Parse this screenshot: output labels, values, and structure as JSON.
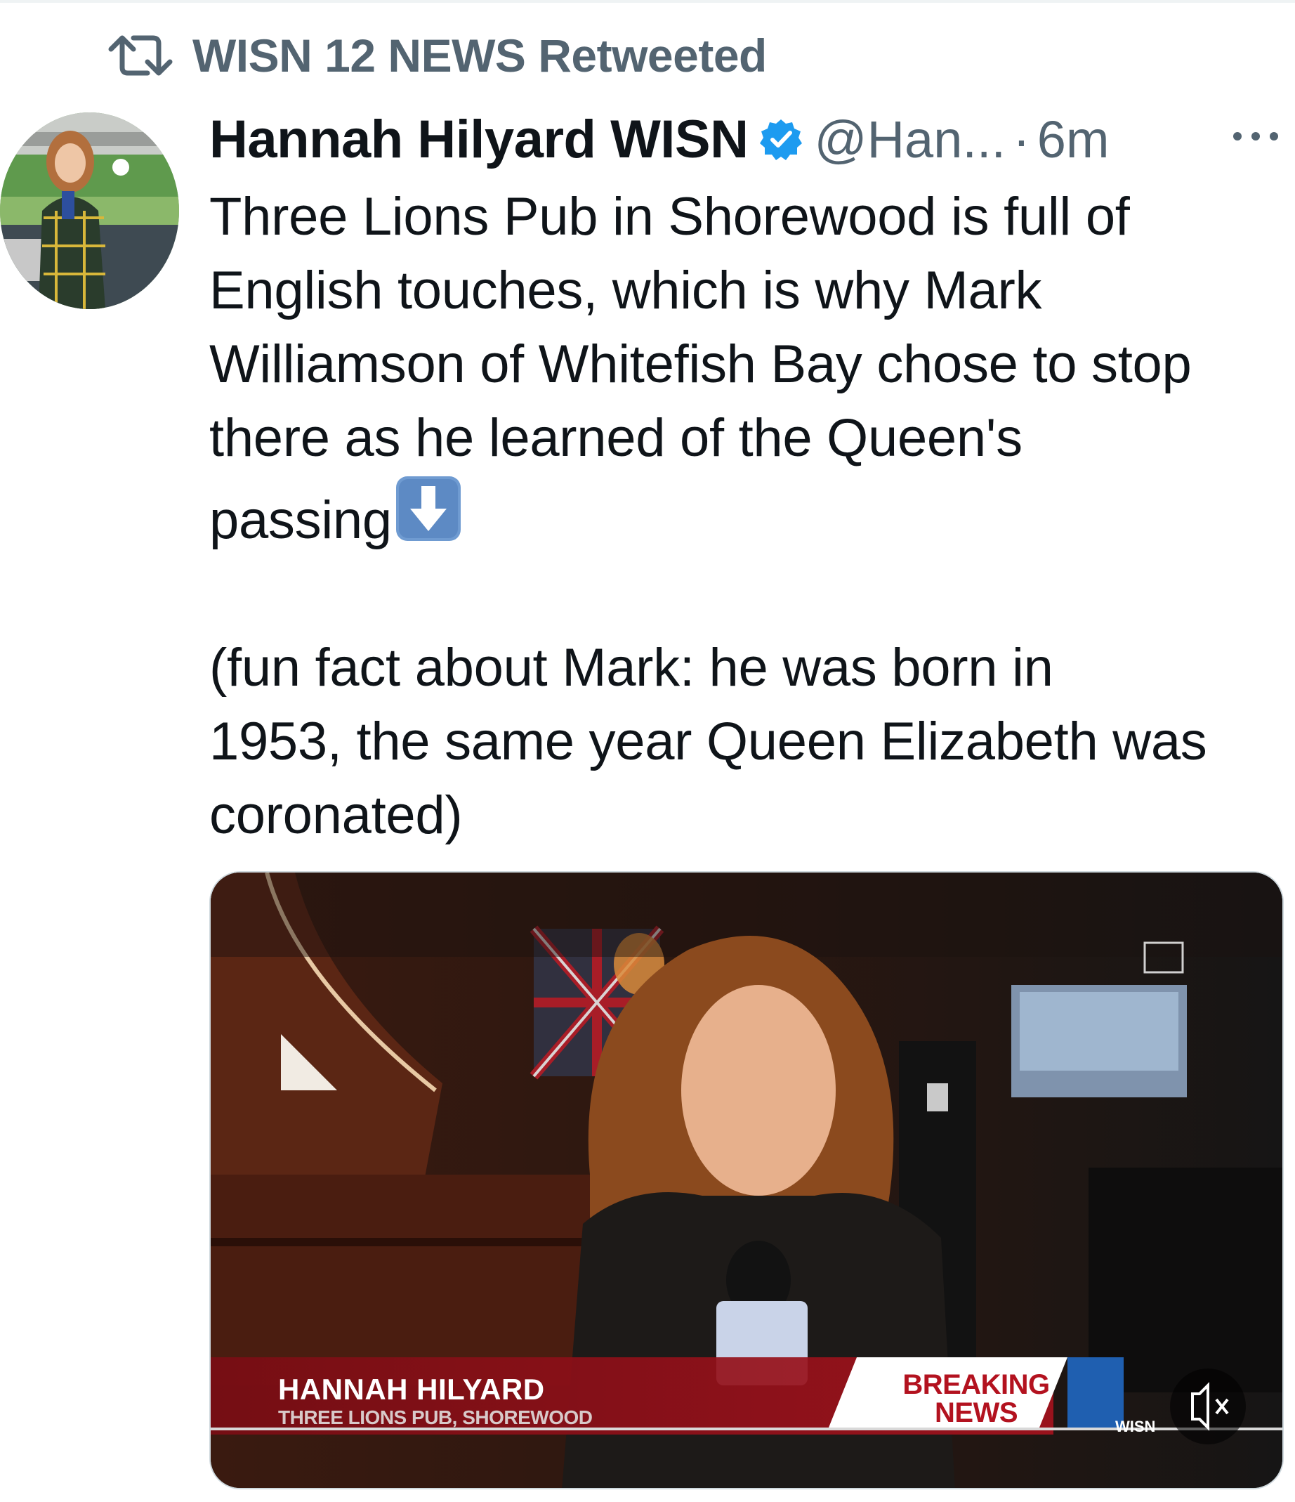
{
  "retweet": {
    "label": "WISN 12 NEWS Retweeted",
    "icon": "retweet-icon"
  },
  "tweet": {
    "display_name": "Hannah Hilyard WISN",
    "verified_icon": "verified-badge-icon",
    "handle": "@Han...",
    "separator": "·",
    "time": "6m",
    "more_icon": "more-dots-icon",
    "text_part1": "Three Lions Pub in Shorewood is full of\nEnglish touches, which is why Mark\nWilliamson of Whitefish Bay chose to stop\nthere as he learned of the Queen's\npassing",
    "emoji_icon": "down-arrow-emoji-icon",
    "text_part2": "\n\n(fun fact about Mark: he was born in\n1953, the same year Queen Elizabeth was\ncoronated)"
  },
  "video": {
    "lower_third_name": "HANNAH HILYARD",
    "lower_third_location": "THREE LIONS PUB, SHOREWOOD",
    "breaking_line1": "BREAKING",
    "breaking_line2": "NEWS",
    "station_logo_text": "WISN",
    "live_cc_icon": "live-captions-icon",
    "mute_icon": "muted-speaker-icon"
  },
  "colors": {
    "text_primary": "#0f1419",
    "text_secondary": "#536471",
    "verified_blue": "#1d9bf0",
    "news_red": "#8e0f18"
  }
}
